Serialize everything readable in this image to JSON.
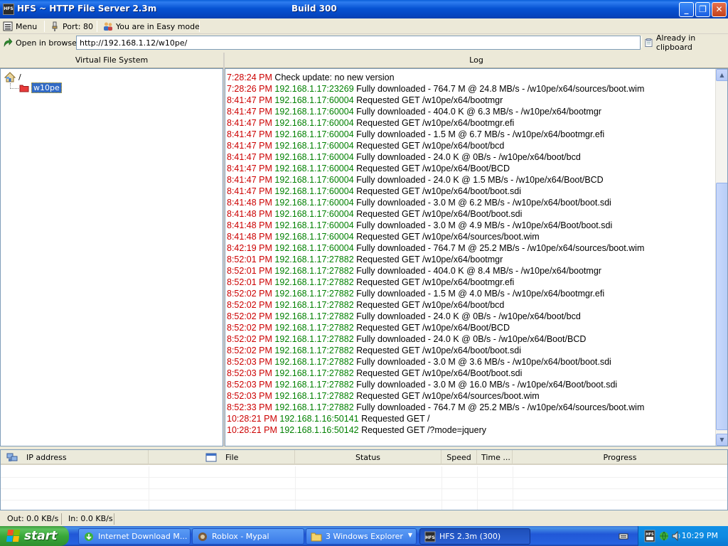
{
  "window": {
    "title": "HFS ~ HTTP File Server 2.3m",
    "build": "Build 300",
    "app_icon_text": "HFS",
    "minimize_glyph": "_",
    "restore_glyph": "❐",
    "close_glyph": "✕"
  },
  "toolbar": {
    "menu_label": "Menu",
    "port_label": "Port: 80",
    "mode_label": "You are in Easy mode",
    "open_browser_label": "Open in browser",
    "url_value": "http://192.168.1.12/w10pe/",
    "clipboard_label": "Already in clipboard"
  },
  "vfs": {
    "header": "Virtual File System",
    "root_label": "/",
    "items": [
      {
        "label": "w10pe"
      }
    ]
  },
  "log": {
    "header": "Log",
    "entries": [
      {
        "time": "7:28:24 PM",
        "ip": "",
        "msg": "Check update: no new version"
      },
      {
        "time": "7:28:26 PM",
        "ip": "192.168.1.17:23269",
        "msg": "Fully downloaded - 764.7 M @ 24.8 MB/s - /w10pe/x64/sources/boot.wim"
      },
      {
        "time": "8:41:47 PM",
        "ip": "192.168.1.17:60004",
        "msg": "Requested GET /w10pe/x64/bootmgr"
      },
      {
        "time": "8:41:47 PM",
        "ip": "192.168.1.17:60004",
        "msg": "Fully downloaded - 404.0 K @ 6.3 MB/s - /w10pe/x64/bootmgr"
      },
      {
        "time": "8:41:47 PM",
        "ip": "192.168.1.17:60004",
        "msg": "Requested GET /w10pe/x64/bootmgr.efi"
      },
      {
        "time": "8:41:47 PM",
        "ip": "192.168.1.17:60004",
        "msg": "Fully downloaded - 1.5 M @ 6.7 MB/s - /w10pe/x64/bootmgr.efi"
      },
      {
        "time": "8:41:47 PM",
        "ip": "192.168.1.17:60004",
        "msg": "Requested GET /w10pe/x64/boot/bcd"
      },
      {
        "time": "8:41:47 PM",
        "ip": "192.168.1.17:60004",
        "msg": "Fully downloaded - 24.0 K @ 0B/s - /w10pe/x64/boot/bcd"
      },
      {
        "time": "8:41:47 PM",
        "ip": "192.168.1.17:60004",
        "msg": "Requested GET /w10pe/x64/Boot/BCD"
      },
      {
        "time": "8:41:47 PM",
        "ip": "192.168.1.17:60004",
        "msg": "Fully downloaded - 24.0 K @ 1.5 MB/s - /w10pe/x64/Boot/BCD"
      },
      {
        "time": "8:41:47 PM",
        "ip": "192.168.1.17:60004",
        "msg": "Requested GET /w10pe/x64/boot/boot.sdi"
      },
      {
        "time": "8:41:48 PM",
        "ip": "192.168.1.17:60004",
        "msg": "Fully downloaded - 3.0 M @ 6.2 MB/s - /w10pe/x64/boot/boot.sdi"
      },
      {
        "time": "8:41:48 PM",
        "ip": "192.168.1.17:60004",
        "msg": "Requested GET /w10pe/x64/Boot/boot.sdi"
      },
      {
        "time": "8:41:48 PM",
        "ip": "192.168.1.17:60004",
        "msg": "Fully downloaded - 3.0 M @ 4.9 MB/s - /w10pe/x64/Boot/boot.sdi"
      },
      {
        "time": "8:41:48 PM",
        "ip": "192.168.1.17:60004",
        "msg": "Requested GET /w10pe/x64/sources/boot.wim"
      },
      {
        "time": "8:42:19 PM",
        "ip": "192.168.1.17:60004",
        "msg": "Fully downloaded - 764.7 M @ 25.2 MB/s - /w10pe/x64/sources/boot.wim"
      },
      {
        "time": "8:52:01 PM",
        "ip": "192.168.1.17:27882",
        "msg": "Requested GET /w10pe/x64/bootmgr"
      },
      {
        "time": "8:52:01 PM",
        "ip": "192.168.1.17:27882",
        "msg": "Fully downloaded - 404.0 K @ 8.4 MB/s - /w10pe/x64/bootmgr"
      },
      {
        "time": "8:52:01 PM",
        "ip": "192.168.1.17:27882",
        "msg": "Requested GET /w10pe/x64/bootmgr.efi"
      },
      {
        "time": "8:52:02 PM",
        "ip": "192.168.1.17:27882",
        "msg": "Fully downloaded - 1.5 M @ 4.0 MB/s - /w10pe/x64/bootmgr.efi"
      },
      {
        "time": "8:52:02 PM",
        "ip": "192.168.1.17:27882",
        "msg": "Requested GET /w10pe/x64/boot/bcd"
      },
      {
        "time": "8:52:02 PM",
        "ip": "192.168.1.17:27882",
        "msg": "Fully downloaded - 24.0 K @ 0B/s - /w10pe/x64/boot/bcd"
      },
      {
        "time": "8:52:02 PM",
        "ip": "192.168.1.17:27882",
        "msg": "Requested GET /w10pe/x64/Boot/BCD"
      },
      {
        "time": "8:52:02 PM",
        "ip": "192.168.1.17:27882",
        "msg": "Fully downloaded - 24.0 K @ 0B/s - /w10pe/x64/Boot/BCD"
      },
      {
        "time": "8:52:02 PM",
        "ip": "192.168.1.17:27882",
        "msg": "Requested GET /w10pe/x64/boot/boot.sdi"
      },
      {
        "time": "8:52:03 PM",
        "ip": "192.168.1.17:27882",
        "msg": "Fully downloaded - 3.0 M @ 3.6 MB/s - /w10pe/x64/boot/boot.sdi"
      },
      {
        "time": "8:52:03 PM",
        "ip": "192.168.1.17:27882",
        "msg": "Requested GET /w10pe/x64/Boot/boot.sdi"
      },
      {
        "time": "8:52:03 PM",
        "ip": "192.168.1.17:27882",
        "msg": "Fully downloaded - 3.0 M @ 16.0 MB/s - /w10pe/x64/Boot/boot.sdi"
      },
      {
        "time": "8:52:03 PM",
        "ip": "192.168.1.17:27882",
        "msg": "Requested GET /w10pe/x64/sources/boot.wim"
      },
      {
        "time": "8:52:33 PM",
        "ip": "192.168.1.17:27882",
        "msg": "Fully downloaded - 764.7 M @ 25.2 MB/s - /w10pe/x64/sources/boot.wim"
      },
      {
        "time": "10:28:21 PM",
        "ip": "192.168.1.16:50141",
        "msg": "Requested GET /"
      },
      {
        "time": "10:28:21 PM",
        "ip": "192.168.1.16:50142",
        "msg": "Requested GET /?mode=jquery"
      }
    ]
  },
  "connections": {
    "columns": [
      "IP address",
      "File",
      "Status",
      "Speed",
      "Time ...",
      "Progress"
    ]
  },
  "statusbar": {
    "out": "Out: 0.0 KB/s",
    "in": "In: 0.0 KB/s"
  },
  "taskbar": {
    "start_label": "start",
    "tasks": [
      {
        "label": "Internet Download M...",
        "icon": "idm-icon"
      },
      {
        "label": "Roblox - Mypal",
        "icon": "browser-icon"
      },
      {
        "label": "3 Windows Explorer",
        "icon": "folder-icon"
      },
      {
        "label": "HFS 2.3m (300)",
        "icon": "hfs-icon"
      }
    ],
    "clock": "10:29 PM"
  },
  "colors": {
    "log_time": "#cc0000",
    "log_ip": "#008000",
    "selection": "#316ac5"
  }
}
